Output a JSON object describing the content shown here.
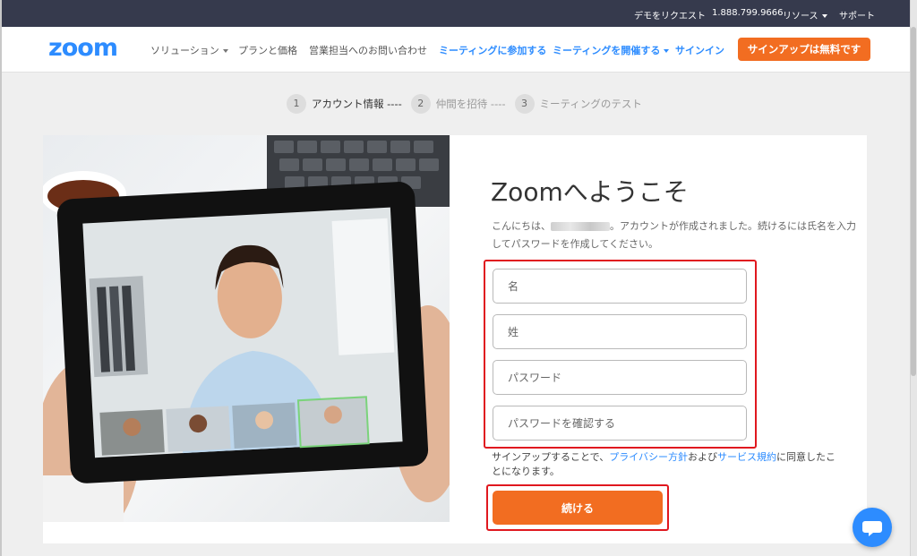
{
  "topbar": {
    "demo_request": "デモをリクエスト",
    "phone": "1.888.799.9666",
    "resources": "リソース",
    "support": "サポート"
  },
  "nav": {
    "logo": "zoom",
    "solutions": "ソリューション",
    "plans": "プランと価格",
    "contact_sales": "営業担当へのお問い合わせ",
    "join_meeting": "ミーティングに参加する",
    "host_meeting": "ミーティングを開催する",
    "sign_in": "サインイン",
    "sign_up_free": "サインアップは無料です"
  },
  "steps": [
    {
      "num": "1",
      "label": "アカウント情報 ----",
      "state": "active"
    },
    {
      "num": "2",
      "label": "仲間を招待 ----",
      "state": "inactive"
    },
    {
      "num": "3",
      "label": "ミーティングのテスト",
      "state": "inactive"
    }
  ],
  "welcome": {
    "title": "Zoomへようこそ",
    "text_before": "こんにちは、",
    "text_after": "。アカウントが作成されました。続けるには氏名を入力してパスワードを作成してください。"
  },
  "form": {
    "first_name_placeholder": "名",
    "last_name_placeholder": "姓",
    "password_placeholder": "パスワード",
    "confirm_password_placeholder": "パスワードを確認する"
  },
  "terms": {
    "prefix": "サインアップすることで、",
    "privacy_link": "プライバシー方針",
    "middle": "および",
    "service_link": "サービス規約",
    "suffix": "に同意したことになります。"
  },
  "continue_label": "続ける",
  "colors": {
    "brand_blue": "#2d8cff",
    "brand_orange": "#f26d21",
    "topbar_bg": "#363a4d",
    "highlight_red": "#e0181f"
  },
  "icons": {
    "chat": "chat-bubble-icon"
  }
}
